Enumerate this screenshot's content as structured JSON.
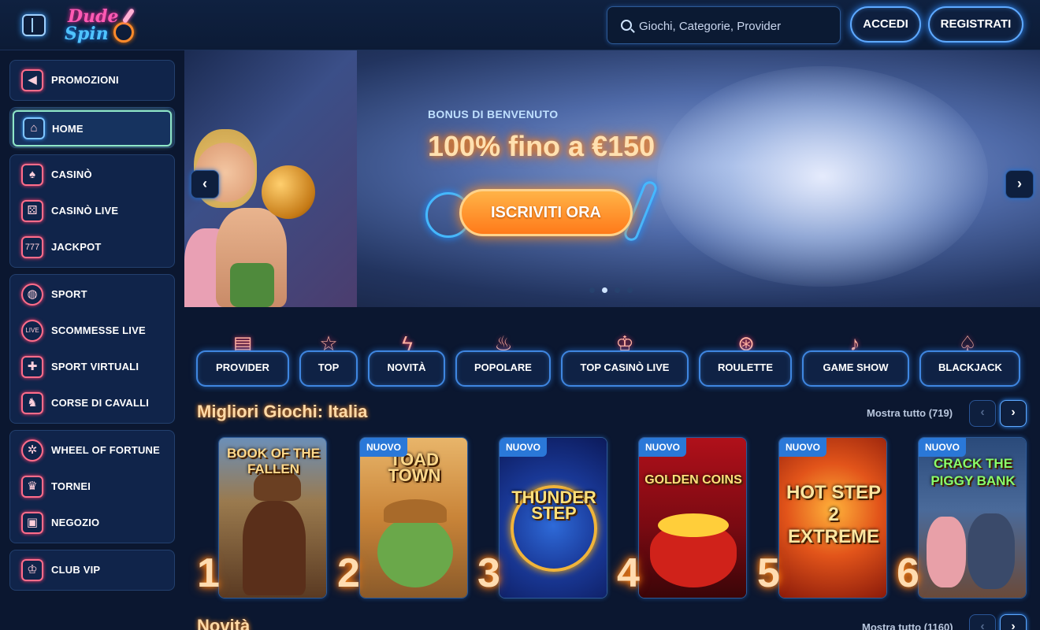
{
  "header": {
    "logo_line1": "Dude",
    "logo_line2": "Spin",
    "search_placeholder": "Giochi, Categorie, Provider",
    "login_label": "ACCEDI",
    "register_label": "REGISTRATI"
  },
  "sidebar": {
    "items": [
      {
        "label": "PROMOZIONI",
        "icon": "megaphone-icon"
      },
      {
        "label": "HOME",
        "icon": "home-icon",
        "active": true
      },
      {
        "label": "CASINÒ",
        "icon": "spade-icon"
      },
      {
        "label": "CASINÒ LIVE",
        "icon": "dice-icon"
      },
      {
        "label": "JACKPOT",
        "icon": "slot-777-icon"
      },
      {
        "label": "SPORT",
        "icon": "ball-icon"
      },
      {
        "label": "SCOMMESSE LIVE",
        "icon": "live-icon"
      },
      {
        "label": "SPORT VIRTUALI",
        "icon": "gamepad-icon"
      },
      {
        "label": "CORSE DI CAVALLI",
        "icon": "horse-icon"
      },
      {
        "label": "WHEEL OF FORTUNE",
        "icon": "wheel-icon"
      },
      {
        "label": "TORNEI",
        "icon": "trophy-icon"
      },
      {
        "label": "NEGOZIO",
        "icon": "shop-bag-icon"
      },
      {
        "label": "CLUB VIP",
        "icon": "crown-icon"
      }
    ]
  },
  "hero": {
    "subtitle": "BONUS DI BENVENUTO",
    "title": "100% fino a €150",
    "cta_label": "ISCRIVITI ORA",
    "slides_total": 4,
    "active_slide": 2
  },
  "categories": [
    {
      "label": "PROVIDER",
      "icon": "book-icon"
    },
    {
      "label": "TOP",
      "icon": "star-icon"
    },
    {
      "label": "NOVITÀ",
      "icon": "lightning-icon"
    },
    {
      "label": "POPOLARE",
      "icon": "flame-icon"
    },
    {
      "label": "TOP CASINÒ LIVE",
      "icon": "crown-icon"
    },
    {
      "label": "ROULETTE",
      "icon": "roulette-icon"
    },
    {
      "label": "GAME SHOW",
      "icon": "microphone-icon"
    },
    {
      "label": "BLACKJACK",
      "icon": "cards-icon"
    }
  ],
  "section_top": {
    "title": "Migliori Giochi: Italia",
    "more_label": "Mostra tutto (719)",
    "games": [
      {
        "rank": "1",
        "name": "BOOK OF THE FALLEN",
        "badge": ""
      },
      {
        "rank": "2",
        "name": "TOAD TOWN",
        "badge": "NUOVO"
      },
      {
        "rank": "3",
        "name": "THUNDER STEP",
        "badge": "NUOVO"
      },
      {
        "rank": "4",
        "name": "GOLDEN COINS",
        "badge": "NUOVO"
      },
      {
        "rank": "5",
        "name": "HOT STEP 2 EXTREME",
        "badge": "NUOVO"
      },
      {
        "rank": "6",
        "name": "CRACK THE PIGGY BANK",
        "badge": "NUOVO"
      }
    ]
  },
  "section_new": {
    "title": "Novità",
    "more_label": "Mostra tutto (1160)"
  },
  "colors": {
    "bg": "#0b1730",
    "accent_blue": "#3f86e0",
    "accent_orange": "#ff8a1a",
    "badge_blue": "#2a78d8"
  }
}
